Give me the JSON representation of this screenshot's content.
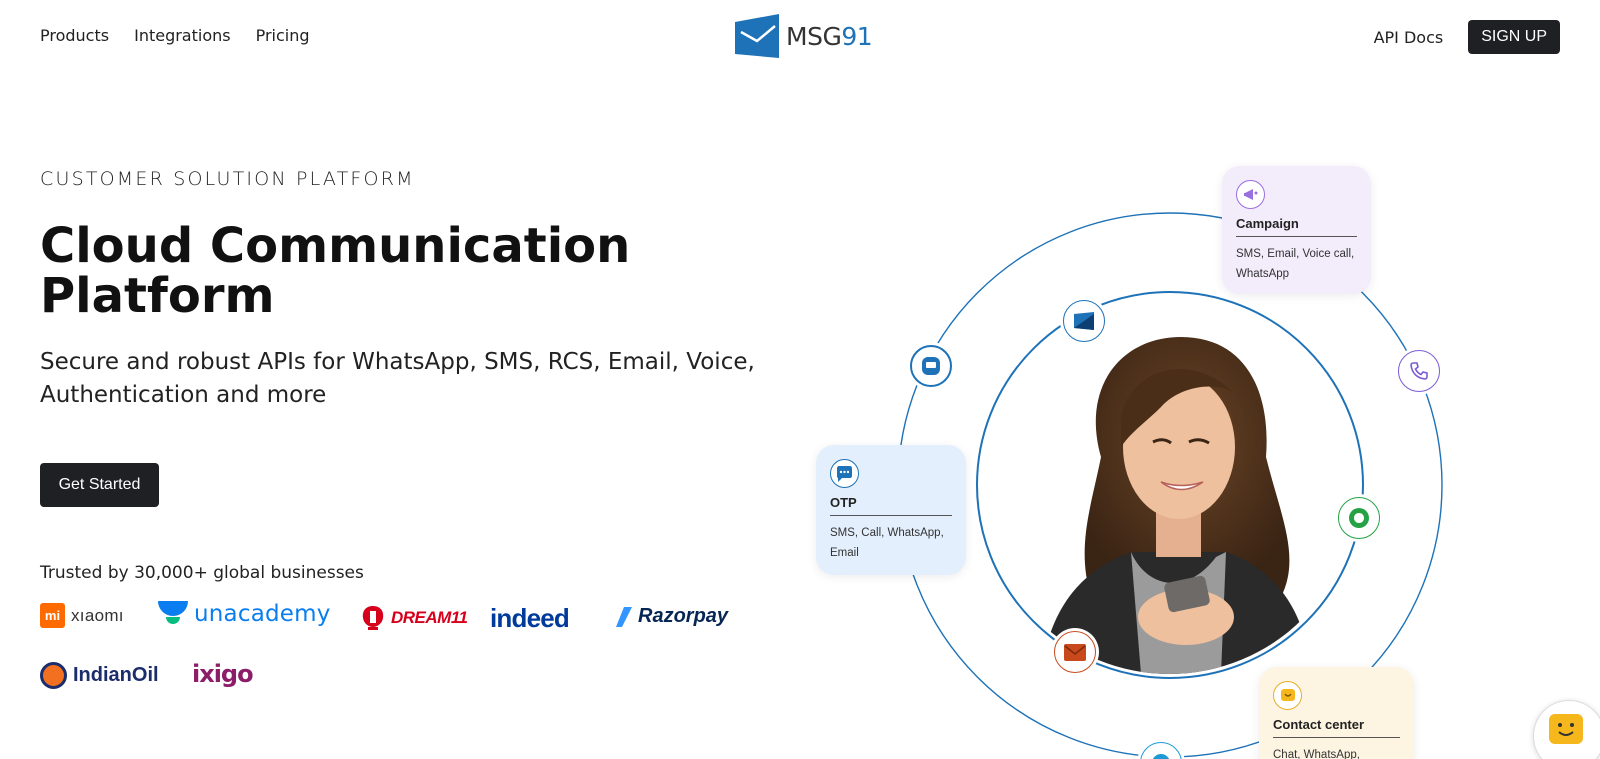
{
  "header": {
    "nav": [
      "Products",
      "Integrations",
      "Pricing"
    ],
    "logo_text": "MSG",
    "logo_num": "91",
    "api_docs": "API Docs",
    "signup": "SIGN UP"
  },
  "hero": {
    "eyebrow": "CUSTOMER SOLUTION PLATFORM",
    "title": "Cloud Communication Platform",
    "subtitle": "Secure and robust APIs for WhatsApp, SMS, RCS, Email, Voice, Authentication and more",
    "cta": "Get Started",
    "trusted": "Trusted by 30,000+ global businesses"
  },
  "brands": {
    "xiaomi_mark": "mi",
    "xiaomi": "xıaomı",
    "unacademy": "unacademy",
    "dream11": "DREAM11",
    "indeed": "indeed",
    "razorpay": "Razorpay",
    "indianoil": "IndianOil",
    "ixigo": "ixigo"
  },
  "cards": {
    "campaign": {
      "title": "Campaign",
      "desc": "SMS, Email, Voice call, WhatsApp",
      "icon": "megaphone-icon"
    },
    "otp": {
      "title": "OTP",
      "desc": "SMS, Call, WhatsApp, Email",
      "icon": "chat-bubble-icon"
    },
    "contact": {
      "title": "Contact center",
      "desc": "Chat, WhatsApp,",
      "icon": "smiley-chat-icon"
    }
  },
  "colors": {
    "brand_blue": "#1d72b8",
    "dark_button": "#1e2023",
    "campaign_bg": "#f2ecfb",
    "otp_bg": "#e3effd",
    "contact_bg": "#fdf5e1"
  }
}
